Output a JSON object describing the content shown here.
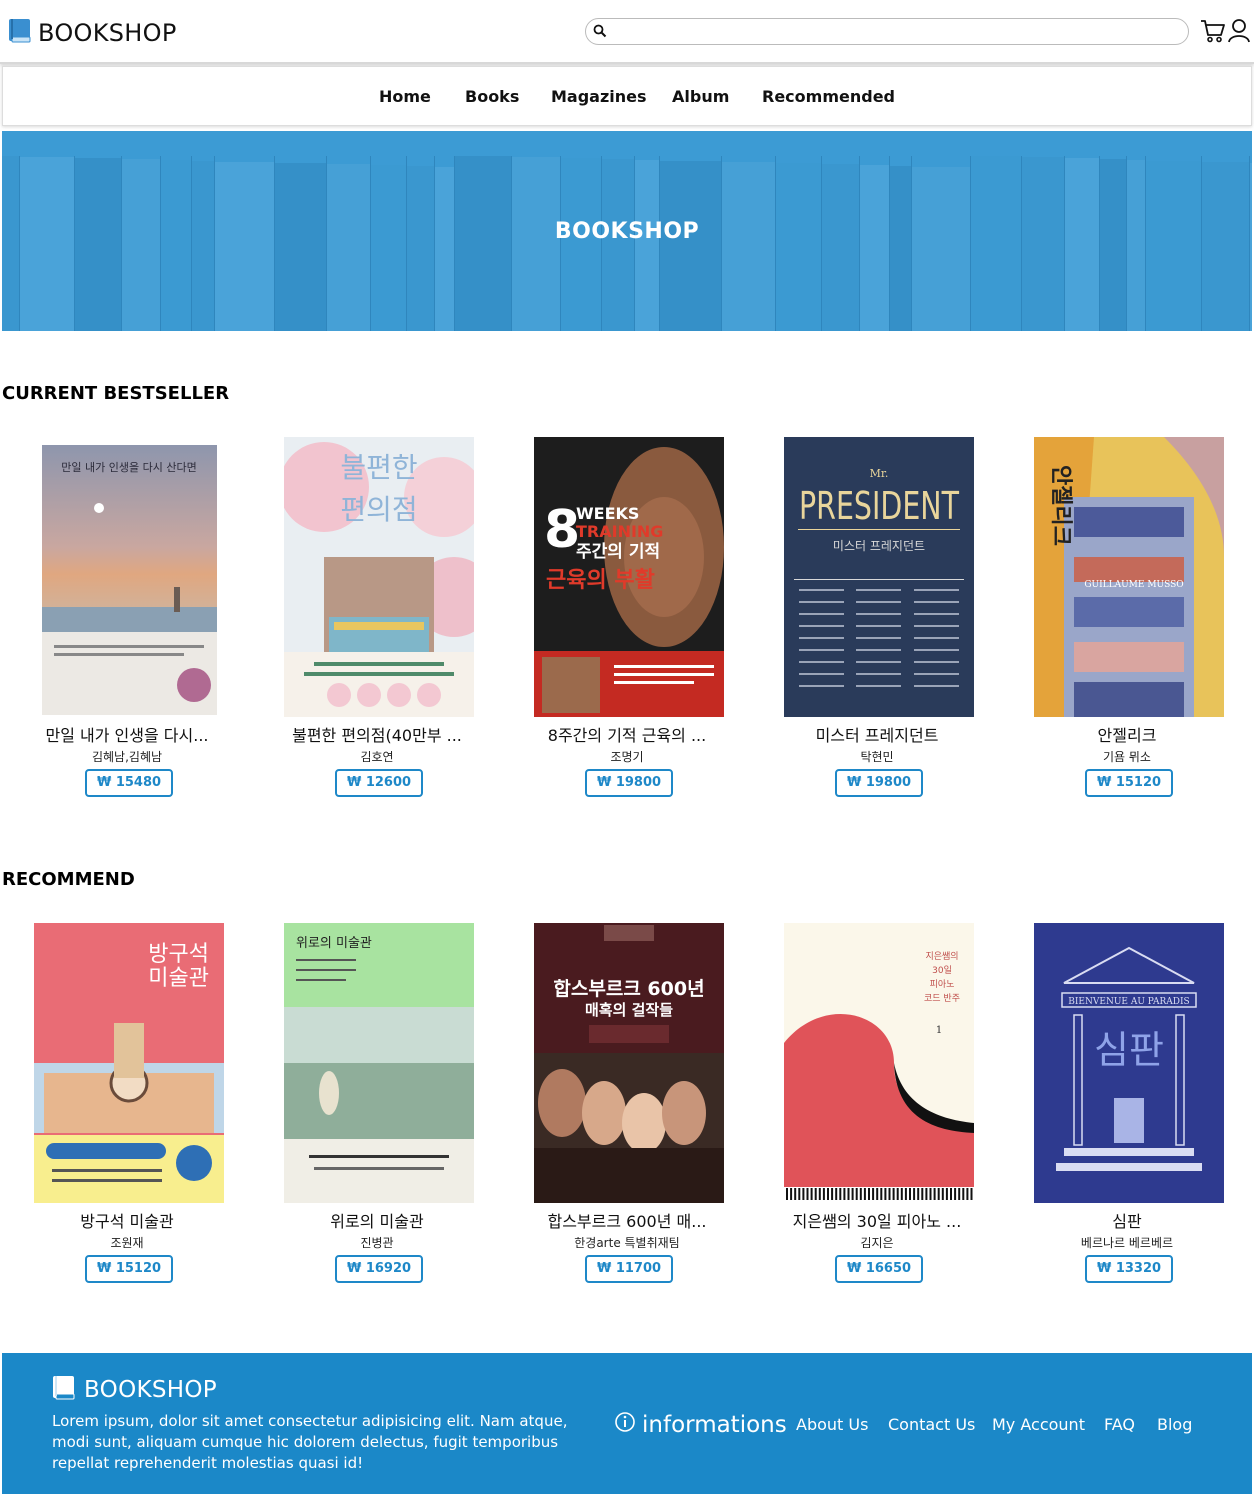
{
  "header": {
    "logo_text": "BOOKSHOP",
    "search_placeholder": "",
    "icons": [
      "book-icon",
      "search-icon",
      "cart-icon",
      "user-icon"
    ]
  },
  "nav": {
    "items": [
      "Home",
      "Books",
      "Magazines",
      "Album",
      "Recommended"
    ]
  },
  "hero": {
    "title": "BOOKSHOP"
  },
  "bestseller": {
    "title": "CURRENT BESTSELLER",
    "books": [
      {
        "title": "만일 내가 인생을 다시...",
        "author": "김혜남,김혜남",
        "price": "₩ 15480",
        "cover_text": "만일 내가 인생을 다시 산다면"
      },
      {
        "title": "불편한 편의점(40만부 ...",
        "author": "김호연",
        "price": "₩ 12600",
        "cover_text": "불편한 편의점"
      },
      {
        "title": "8주간의 기적 근육의 ...",
        "author": "조명기",
        "price": "₩ 19800",
        "cover_text": "8주간의 기적 근육의 부활"
      },
      {
        "title": "미스터 프레지던트",
        "author": "탁현민",
        "price": "₩ 19800",
        "cover_text": "PRESIDENT"
      },
      {
        "title": "안젤리크",
        "author": "기욤 뮈소",
        "price": "₩ 15120",
        "cover_text": "안젤리크"
      }
    ]
  },
  "recommend": {
    "title": "RECOMMEND",
    "books": [
      {
        "title": "방구석 미술관",
        "author": "조원재",
        "price": "₩ 15120",
        "cover_text": "방구석 미술관"
      },
      {
        "title": "위로의 미술관",
        "author": "진병관",
        "price": "₩ 16920",
        "cover_text": "위로의 미술관"
      },
      {
        "title": "합스부르크 600년 매...",
        "author": "한경arte 특별취재팀",
        "price": "₩ 11700",
        "cover_text": "합스부르크 600년"
      },
      {
        "title": "지은쌤의 30일 피아노 ...",
        "author": "김지은",
        "price": "₩ 16650",
        "cover_text": "지은쌤의 30일 피아노 코드 반주"
      },
      {
        "title": "심판",
        "author": "베르나르 베르베르",
        "price": "₩ 13320",
        "cover_text": "심판"
      }
    ]
  },
  "footer": {
    "logo_text": "BOOKSHOP",
    "description": "Lorem ipsum, dolor sit amet consectetur adipisicing elit. Nam atque, modi sunt, aliquam cumque hic dolorem delectus, fugit temporibus repellat reprehenderit molestias quasi id!",
    "info_label": "informations",
    "links": [
      "About Us",
      "Contact Us",
      "My Account",
      "FAQ",
      "Blog"
    ]
  },
  "colors": {
    "accent": "#1e88c8",
    "hero_bg": "#3c9bd4",
    "footer_bg": "#1b88c8"
  }
}
